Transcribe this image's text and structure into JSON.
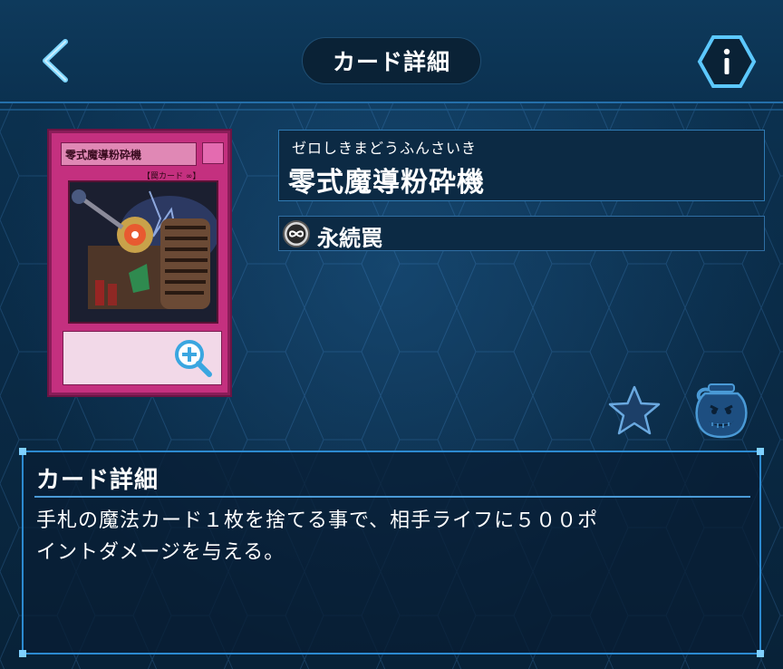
{
  "header": {
    "title": "カード詳細"
  },
  "card": {
    "ruby": "ゼロしきまどうふんさいき",
    "name": "零式魔導粉砕機",
    "card_face_name": "零式魔導粉砕機",
    "card_face_type": "【罠カード ∞】",
    "type_icon": "infinity-icon",
    "type_label": "永続罠"
  },
  "detail": {
    "heading": "カード詳細",
    "text": "手札の魔法カード１枚を捨てる事で、相手ライフに５００ポ\nイントダメージを与える。"
  },
  "colors": {
    "accent": "#2c8ad0",
    "trap_card": "#c4307f",
    "background": "#0a2b47"
  }
}
